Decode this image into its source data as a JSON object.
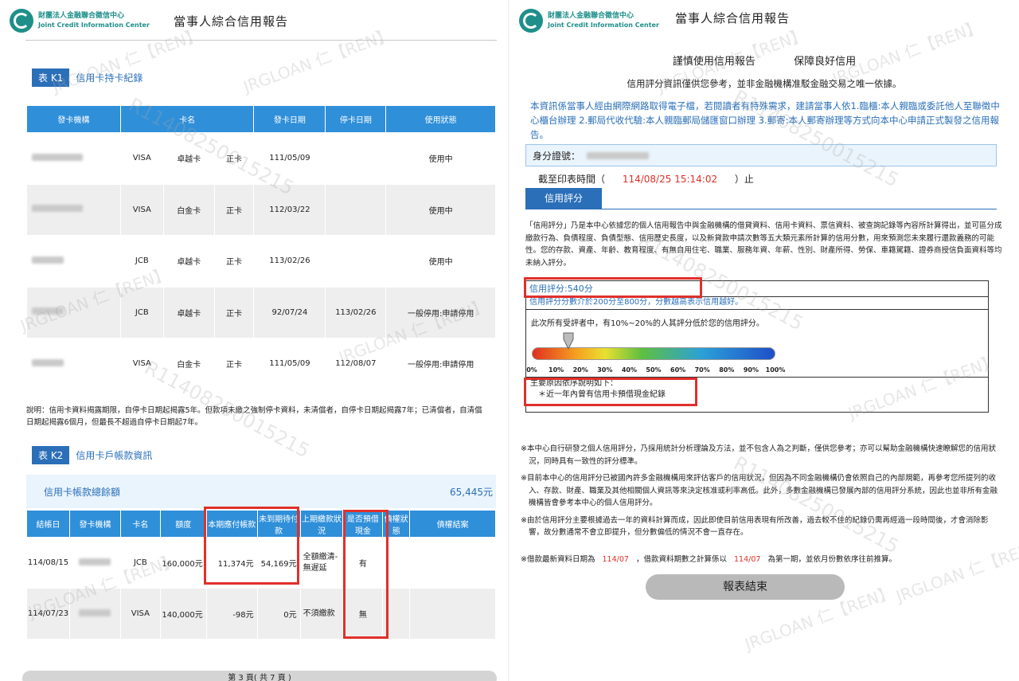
{
  "left": {
    "org_zh": "財團法人金融聯合徵信中心",
    "org_en": "Joint Credit Information Center",
    "title": "當事人綜合信用報告",
    "k1": {
      "tag": "表 K1",
      "title": "信用卡持卡紀錄",
      "headers": [
        "發卡機構",
        "卡名",
        "發卡日期",
        "停卡日期",
        "使用狀態"
      ],
      "rows": [
        {
          "brand": "VISA",
          "level": "卓越卡",
          "type": "正卡",
          "issue": "111/05/09",
          "stop": "",
          "status": "使用中"
        },
        {
          "brand": "VISA",
          "level": "白金卡",
          "type": "正卡",
          "issue": "112/03/22",
          "stop": "",
          "status": "使用中"
        },
        {
          "brand": "JCB",
          "level": "卓越卡",
          "type": "正卡",
          "issue": "113/02/26",
          "stop": "",
          "status": "使用中"
        },
        {
          "brand": "JCB",
          "level": "卓越卡",
          "type": "正卡",
          "issue": "92/07/24",
          "stop": "113/02/26",
          "status": "一般停用:申請停用"
        },
        {
          "brand": "VISA",
          "level": "白金卡",
          "type": "正卡",
          "issue": "111/05/09",
          "stop": "112/08/07",
          "status": "一般停用:申請停用"
        }
      ],
      "note": "說明：信用卡資料揭露期限，自停卡日期起揭露5年。但款項未繳之強制停卡資料，未清償者，自停卡日期起揭露7年；已清償者，自清償日期起揭露6個月，但最長不超過自停卡日期起7年。"
    },
    "k2": {
      "tag": "表 K2",
      "title": "信用卡戶帳款資訊",
      "total_label": "信用卡帳款總餘額",
      "total_value": "65,445元",
      "headers": [
        "結帳日",
        "發卡機構",
        "卡名",
        "額度",
        "本期應付帳款",
        "未到期待付款",
        "上期繳款狀況",
        "是否預借現金",
        "債權狀態",
        "債權結案"
      ],
      "rows": [
        {
          "date": "114/08/15",
          "brand": "JCB",
          "limit": "160,000元",
          "due": "11,374元",
          "pending": "54,169元",
          "last": "全額繳清-無遲延",
          "cash": "有",
          "state": "",
          "closed": ""
        },
        {
          "date": "114/07/23",
          "brand": "VISA",
          "limit": "140,000元",
          "due": "-98元",
          "pending": "0元",
          "last": "不須繳款",
          "cash": "無",
          "state": "",
          "closed": ""
        }
      ]
    },
    "page": "第 3 頁( 共 7 頁 )"
  },
  "right": {
    "org_zh": "財團法人金融聯合徵信中心",
    "org_en": "Joint Credit Information Center",
    "title": "當事人綜合信用報告",
    "slogan1": "謹慎使用信用報告",
    "slogan2": "保障良好信用",
    "disclaimer": "信用評分資訊僅供您參考，並非金融機構准駁金融交易之唯一依據。",
    "notice": "本資訊係當事人經由網際網路取得電子檔，若閱讀者有特殊需求，建請當事人依1.臨櫃:本人親臨或委託他人至聯徵中心櫃台辦理 2.郵局代收代驗:本人親臨郵局儲匯窗口辦理 3.郵寄:本人郵寄辦理等方式向本中心申請正式製發之信用報告。",
    "id_label": "身分證號：",
    "print_label": "截至印表時間（",
    "print_time": "114/08/25 15:14:02",
    "print_end": "）止",
    "score_tab": "信用評分",
    "desc": "「信用評分」乃是本中心依據您的個人信用報告中與金融機構的借貸資料、信用卡資料、票信資料、被查詢記錄等內容所計算得出，並可區分成繳款行為、負債程度、負債型態、信用歷史長度，以及新貸款申請次數等五大類元素所計算的信用分數，用來預測您未來履行還款義務的可能性。您的存款、資產、年齡、教育程度、有無自用住宅、職業、服務年資、年薪、性別、財產所得、勞保、車籍駕籍、證券商授信負面資料等均未納入評分。",
    "score_label": "信用評分:540分",
    "score_range": "信用評分分數介於200分至800分，分數越高表示信用越好。",
    "percentile_text": "此次所有受評者中，有10%~20%的人其評分低於您的信用評分。",
    "scale_ticks": [
      "0%",
      "10%",
      "20%",
      "30%",
      "40%",
      "50%",
      "60%",
      "70%",
      "80%",
      "90%",
      "100%"
    ],
    "marker_pct": 0.15,
    "reasons_title": "主要原因依序說明如下：",
    "reasons": [
      "＊近一年內曾有信用卡預借現金紀錄"
    ],
    "notes": [
      "※本中心自行研發之個人信用評分，乃採用統計分析理論及方法，並不包含人為之判斷，僅供您參考；亦可以幫助金融機構快速瞭解您的信用狀況，同時具有一致性的評分標準。",
      "※目前本中心的信用評分已被國內許多金融機構用來評估客戶的信用狀況，但因為不同金融機構仍會依照自己的內部規範，再參考您所提列的收入、存款、財產、職業及其他相關個人資訊等來決定核准或利率高低。此外，多數金融機構已發展內部的信用評分系統，因此也並非所有金融機構皆會參考本中心的個人信用評分。",
      "※由於信用評分主要根據過去一年的資料計算而成，因此即使目前信用表現有所改善，過去較不佳的紀錄仍需再經過一段時間後，才會消除影響，故分數通常不會立即提升，但分數偏低的情況不會一直存在。"
    ],
    "last_note_a": "※借款最新資料日期為",
    "last_note_date1": "114/07",
    "last_note_b": "，借款資料期數之計算係以",
    "last_note_date2": "114/07",
    "last_note_c": "為第一期，並依月份數依序往前推算。",
    "end_button": "報表結束"
  },
  "colors": {
    "header_blue": "#2f8fd9",
    "text_blue": "#2b6fb8",
    "red": "#e0302a",
    "teal": "#1f8f8a"
  }
}
